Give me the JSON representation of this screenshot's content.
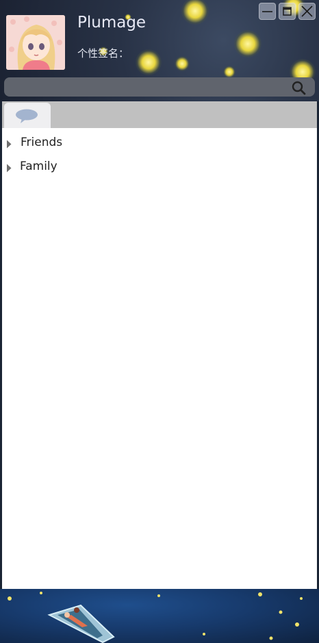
{
  "user": {
    "name": "Plumage",
    "signature_label": "个性签名：",
    "signature_value": ""
  },
  "window_controls": {
    "minimize_icon": "minimize-icon",
    "maximize_icon": "maximize-icon",
    "close_icon": "close-icon"
  },
  "search": {
    "placeholder": "",
    "value": "",
    "icon": "search-icon"
  },
  "tabs": [
    {
      "icon": "chat-bubble-icon",
      "active": true
    }
  ],
  "groups": [
    {
      "label": "Friends",
      "expanded": false
    },
    {
      "label": "Family",
      "expanded": false
    }
  ],
  "colors": {
    "tab_strip": "#c0c0c0",
    "active_tab": "#efeff1",
    "panel": "#ffffff",
    "chat_icon": "#a3b4cf"
  }
}
